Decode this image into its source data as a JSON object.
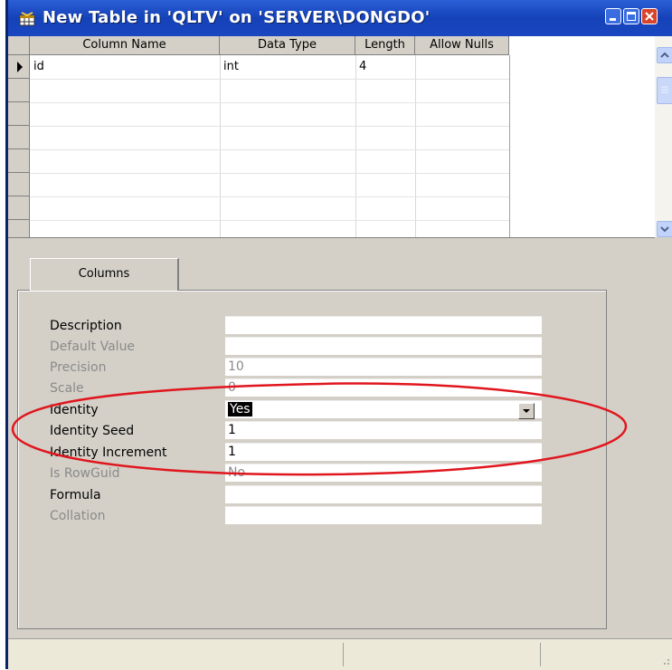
{
  "window": {
    "title": "New Table in 'QLTV' on 'SERVER\\DONGDO'"
  },
  "grid": {
    "columns": [
      "Column Name",
      "Data Type",
      "Length",
      "Allow Nulls"
    ],
    "rows": [
      {
        "name": "id",
        "type": "int",
        "length": "4",
        "allow_nulls": ""
      }
    ]
  },
  "tabs": [
    {
      "label": "Columns"
    }
  ],
  "properties": [
    {
      "label": "Description",
      "value": "",
      "enabled": true
    },
    {
      "label": "Default Value",
      "value": "",
      "enabled": false
    },
    {
      "label": "Precision",
      "value": "10",
      "enabled": false
    },
    {
      "label": "Scale",
      "value": "0",
      "enabled": false
    },
    {
      "label": "Identity",
      "value": "Yes",
      "enabled": true,
      "selected": true
    },
    {
      "label": "Identity Seed",
      "value": "1",
      "enabled": true
    },
    {
      "label": "Identity Increment",
      "value": "1",
      "enabled": true
    },
    {
      "label": "Is RowGuid",
      "value": "No",
      "enabled": false
    },
    {
      "label": "Formula",
      "value": "",
      "enabled": true
    },
    {
      "label": "Collation",
      "value": "",
      "enabled": false
    }
  ],
  "annotation": {
    "color": "#e0161e"
  },
  "colors": {
    "titlebar": "#1a47c0",
    "window_bg": "#d4d0c8"
  }
}
